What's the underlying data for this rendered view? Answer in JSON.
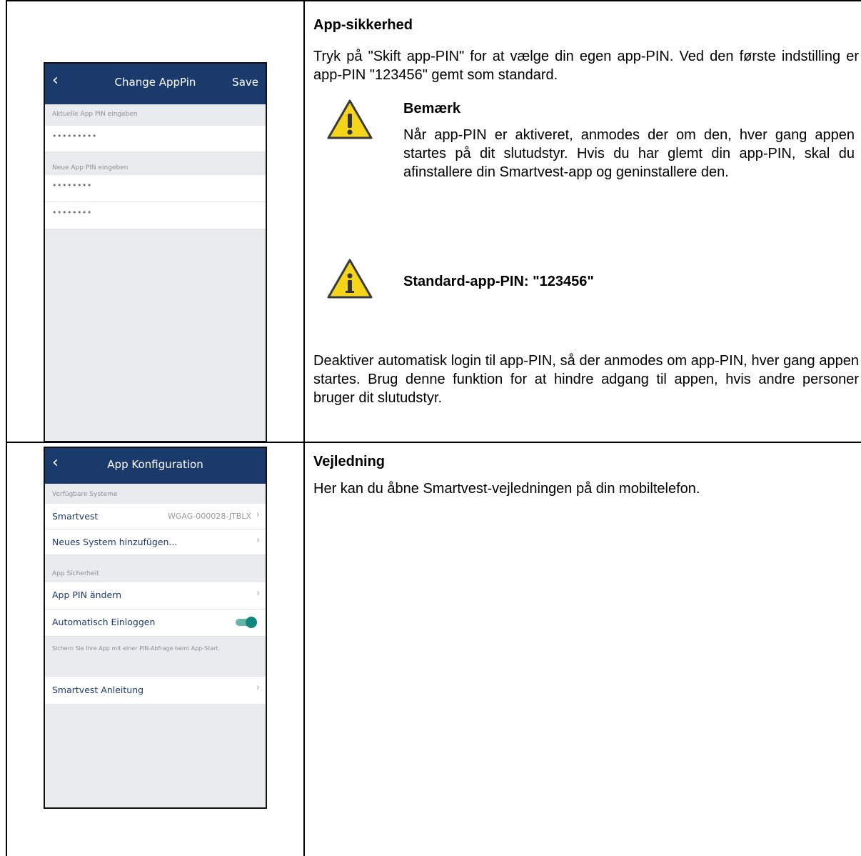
{
  "screen1": {
    "title": "Change AppPin",
    "save": "Save",
    "section_current": "Aktuelle App PIN eingeben",
    "current_value": "•••••••••",
    "section_new": "Neue App PIN eingeben",
    "new_value": "••••••••",
    "confirm_value": "••••••••"
  },
  "screen2": {
    "title": "App Konfiguration",
    "section_systems": "Verfügbare Systeme",
    "systems": [
      {
        "label": "Smartvest",
        "value": "WGAG-000028-JTBLX"
      },
      {
        "label": "Neues System hinzufügen...",
        "value": ""
      }
    ],
    "section_security": "App Sicherheit",
    "pin_change": "App PIN ändern",
    "auto_login": "Automatisch Einloggen",
    "auto_login_on": true,
    "footnote": "Sichern Sie Ihre App mit einer PIN-Abfrage beim App-Start.",
    "guide": "Smartvest Anleitung"
  },
  "right1": {
    "heading": "App-sikkerhed",
    "intro": "Tryk på \"Skift app-PIN\" for at vælge din egen app-PIN. Ved den første indstilling er app-PIN \"123456\" gemt som standard.",
    "note_heading": "Bemærk",
    "note_text": "Når app-PIN er aktiveret, anmodes der om den, hver gang appen startes på dit slutudstyr. Hvis du har glemt din app-PIN, skal du afinstallere din Smartvest-app og geninstallere den.",
    "info_text": "Standard-app-PIN: \"123456\"",
    "outro": "Deaktiver automatisk login til app-PIN, så der anmodes om app-PIN, hver gang appen startes. Brug denne funktion for at hindre adgang til appen, hvis andre personer bruger dit slutudstyr."
  },
  "right2": {
    "heading": "Vejledning",
    "text": "Her kan du åbne Smartvest-vejledningen på din mobiltelefon."
  },
  "icons": {
    "warning": "warning-triangle-icon",
    "info": "info-triangle-icon"
  },
  "colors": {
    "nav": "#1b3a6c",
    "toggle": "#13867a",
    "icon_yellow": "#f4d51a"
  }
}
